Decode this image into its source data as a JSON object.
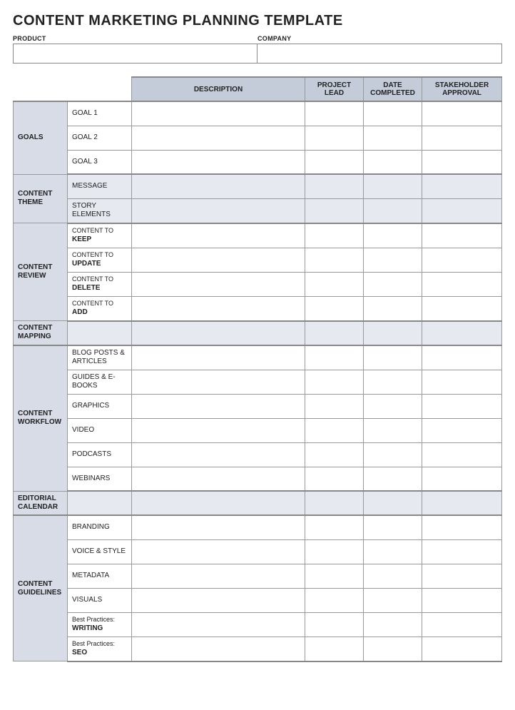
{
  "title": "CONTENT MARKETING PLANNING TEMPLATE",
  "meta": {
    "product_label": "PRODUCT",
    "company_label": "COMPANY",
    "product_value": "",
    "company_value": ""
  },
  "headers": {
    "description": "DESCRIPTION",
    "project_lead": "PROJECT LEAD",
    "date_completed": "DATE COMPLETED",
    "stakeholder_approval": "STAKEHOLDER APPROVAL"
  },
  "sections": {
    "goals": {
      "label": "GOALS",
      "rows": [
        {
          "sub": "GOAL 1",
          "description": "",
          "lead": "",
          "date": "",
          "approval": ""
        },
        {
          "sub": "GOAL 2",
          "description": "",
          "lead": "",
          "date": "",
          "approval": ""
        },
        {
          "sub": "GOAL 3",
          "description": "",
          "lead": "",
          "date": "",
          "approval": ""
        }
      ]
    },
    "content_theme": {
      "label": "CONTENT THEME",
      "rows": [
        {
          "sub": "MESSAGE",
          "description": "",
          "lead": "",
          "date": "",
          "approval": ""
        },
        {
          "sub": "STORY ELEMENTS",
          "description": "",
          "lead": "",
          "date": "",
          "approval": ""
        }
      ]
    },
    "content_review": {
      "label": "CONTENT REVIEW",
      "rows": [
        {
          "pre": "CONTENT TO",
          "bold": "KEEP",
          "description": "",
          "lead": "",
          "date": "",
          "approval": ""
        },
        {
          "pre": "CONTENT TO",
          "bold": "UPDATE",
          "description": "",
          "lead": "",
          "date": "",
          "approval": ""
        },
        {
          "pre": "CONTENT TO",
          "bold": "DELETE",
          "description": "",
          "lead": "",
          "date": "",
          "approval": ""
        },
        {
          "pre": "CONTENT TO",
          "bold": "ADD",
          "description": "",
          "lead": "",
          "date": "",
          "approval": ""
        }
      ]
    },
    "content_mapping": {
      "label": "CONTENT MAPPING",
      "rows": [
        {
          "sub": "",
          "description": "",
          "lead": "",
          "date": "",
          "approval": ""
        }
      ]
    },
    "content_workflow": {
      "label": "CONTENT WORKFLOW",
      "rows": [
        {
          "sub": "BLOG POSTS & ARTICLES",
          "description": "",
          "lead": "",
          "date": "",
          "approval": ""
        },
        {
          "sub": "GUIDES & E-BOOKS",
          "description": "",
          "lead": "",
          "date": "",
          "approval": ""
        },
        {
          "sub": "GRAPHICS",
          "description": "",
          "lead": "",
          "date": "",
          "approval": ""
        },
        {
          "sub": "VIDEO",
          "description": "",
          "lead": "",
          "date": "",
          "approval": ""
        },
        {
          "sub": "PODCASTS",
          "description": "",
          "lead": "",
          "date": "",
          "approval": ""
        },
        {
          "sub": "WEBINARS",
          "description": "",
          "lead": "",
          "date": "",
          "approval": ""
        }
      ]
    },
    "editorial_calendar": {
      "label": "EDITORIAL CALENDAR",
      "rows": [
        {
          "sub": "",
          "description": "",
          "lead": "",
          "date": "",
          "approval": ""
        }
      ]
    },
    "content_guidelines": {
      "label": "CONTENT GUIDELINES",
      "rows": [
        {
          "sub": "BRANDING",
          "description": "",
          "lead": "",
          "date": "",
          "approval": ""
        },
        {
          "sub": "VOICE & STYLE",
          "description": "",
          "lead": "",
          "date": "",
          "approval": ""
        },
        {
          "sub": "METADATA",
          "description": "",
          "lead": "",
          "date": "",
          "approval": ""
        },
        {
          "sub": "VISUALS",
          "description": "",
          "lead": "",
          "date": "",
          "approval": ""
        },
        {
          "pre": "Best Practices:",
          "bold": "WRITING",
          "description": "",
          "lead": "",
          "date": "",
          "approval": ""
        },
        {
          "pre": "Best Practices:",
          "bold": "SEO",
          "description": "",
          "lead": "",
          "date": "",
          "approval": ""
        }
      ]
    }
  }
}
